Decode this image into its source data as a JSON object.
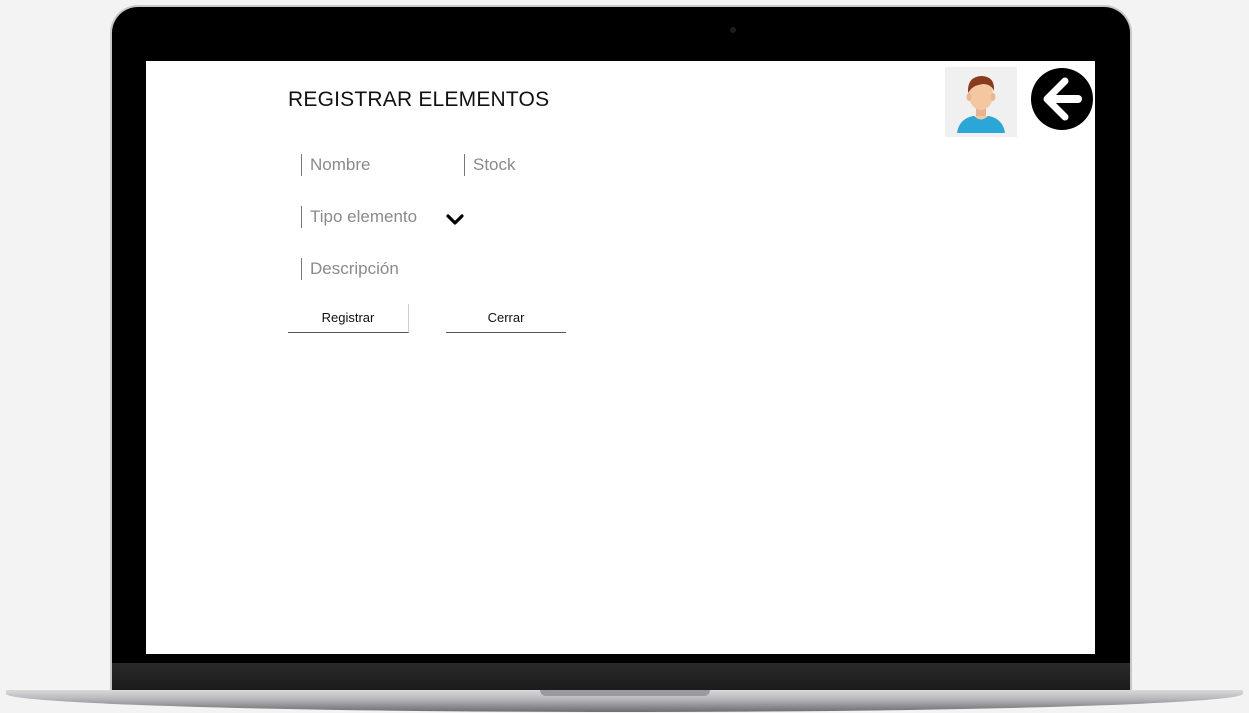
{
  "page": {
    "title": "REGISTRAR ELEMENTOS"
  },
  "form": {
    "nombre_placeholder": "Nombre",
    "stock_placeholder": "Stock",
    "tipo_placeholder": "Tipo elemento",
    "descripcion_placeholder": "Descripción"
  },
  "buttons": {
    "registrar_label": "Registrar",
    "cerrar_label": "Cerrar"
  },
  "icons": {
    "avatar": "user-avatar-icon",
    "back": "arrow-left-circle-icon",
    "dropdown": "chevron-down-icon"
  },
  "colors": {
    "screen_bg": "#ffffff",
    "frame": "#000000",
    "avatar_skin": "#f4c7a1",
    "avatar_hair": "#8b3a1e",
    "avatar_shirt": "#2aa7d6"
  }
}
